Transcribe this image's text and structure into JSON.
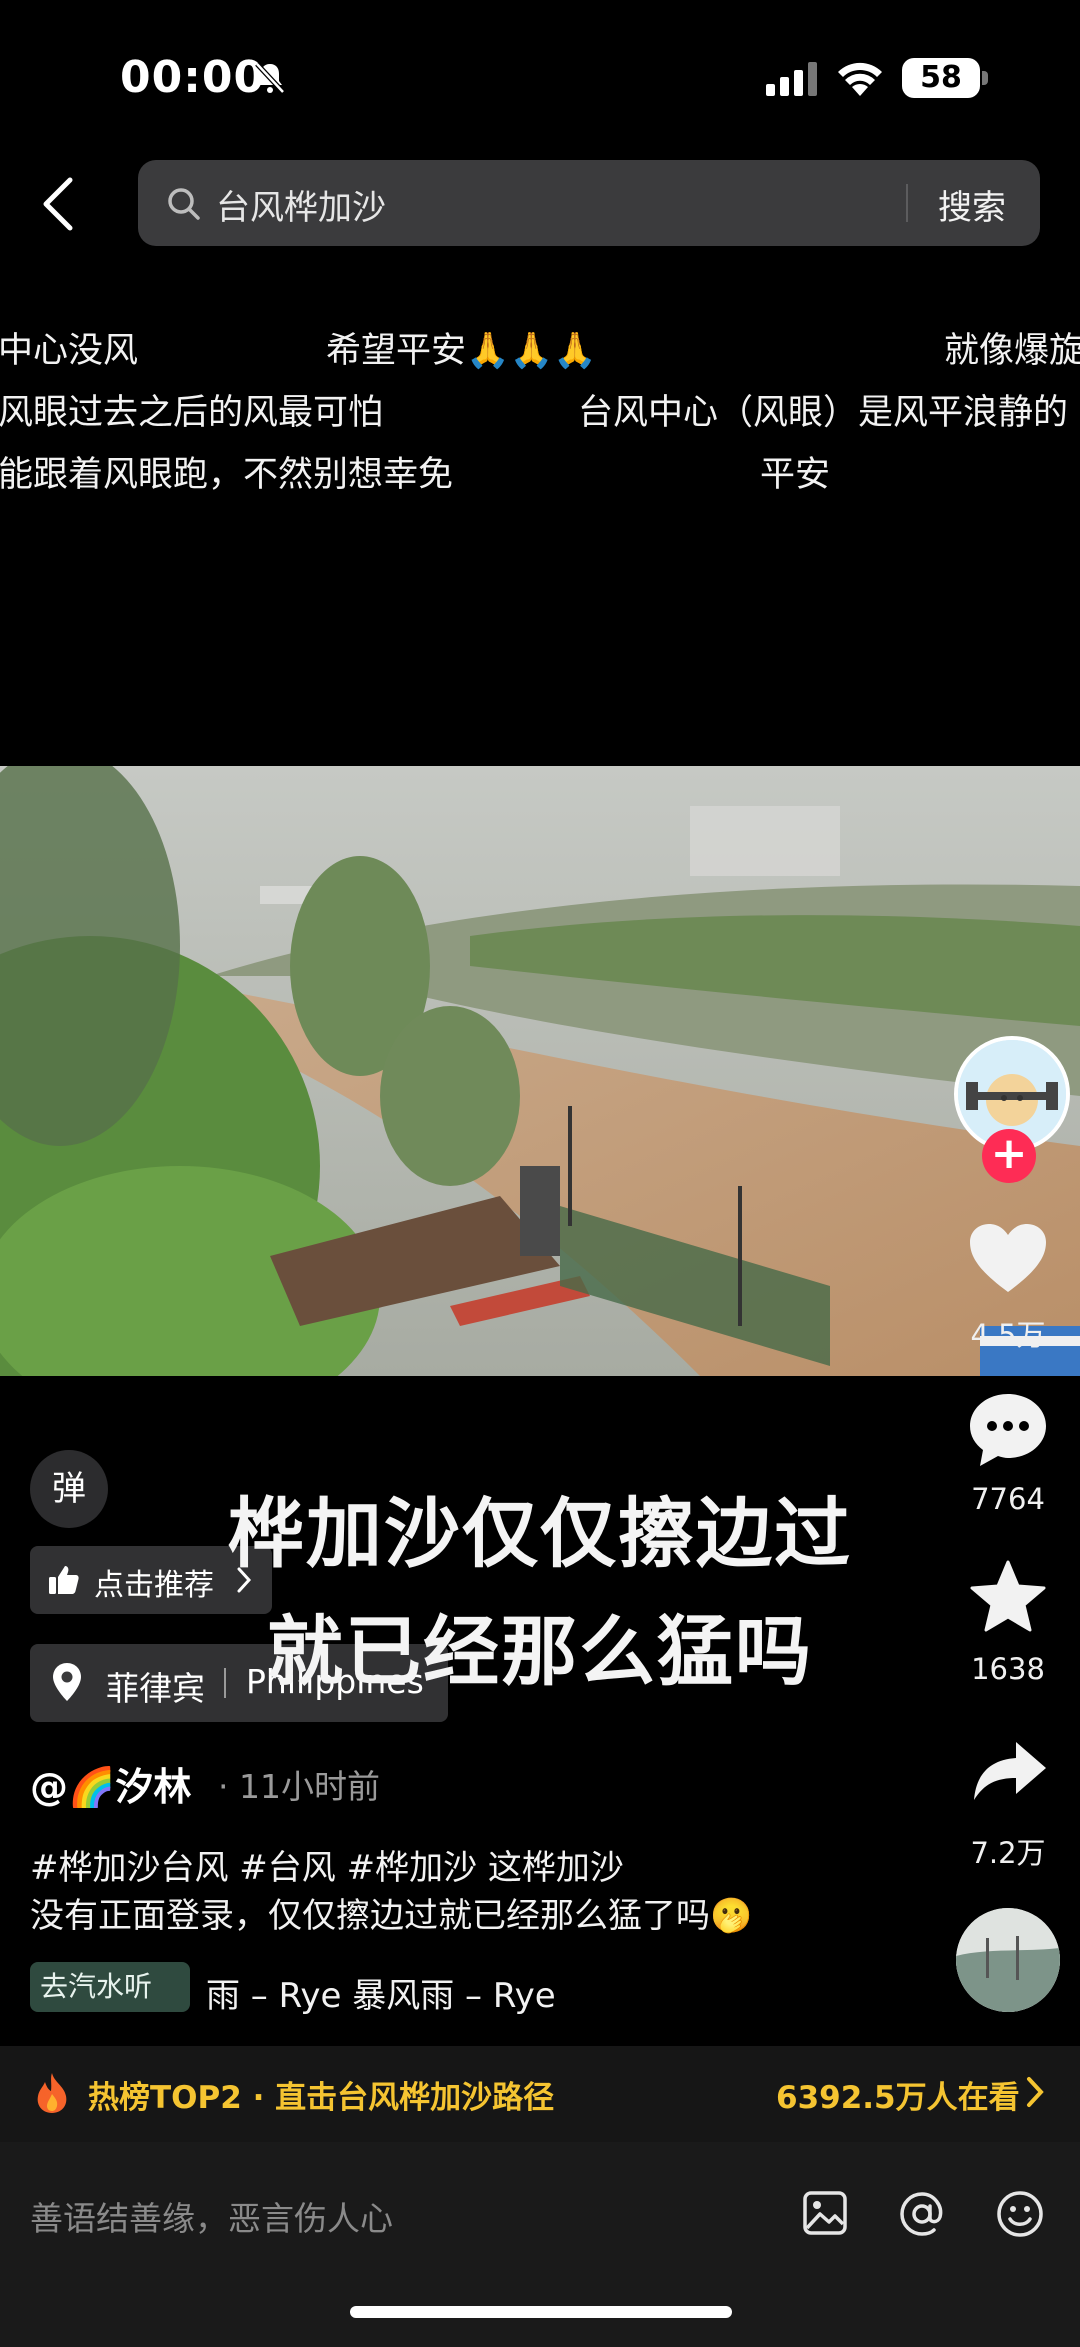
{
  "status_bar": {
    "time": "00:00",
    "battery": "58"
  },
  "search": {
    "query": "台风桦加沙",
    "button_label": "搜索"
  },
  "danmaku": [
    "中心没风",
    "希望平安🙏🙏🙏",
    "就像爆旋",
    "风眼过去之后的风最可怕",
    "台风中心（风眼）是风平浪静的",
    "能跟着风眼跑，不然别想幸免",
    "平安"
  ],
  "video": {
    "overlay_line1": "桦加沙仅仅擦边过",
    "overlay_line2": "就已经那么猛吗"
  },
  "actions": {
    "like_count": "4.5万",
    "comment_count": "7764",
    "favorite_count": "1638",
    "share_count": "7.2万"
  },
  "danmu_toggle": "弹",
  "recommend_label": "点击推荐",
  "location": {
    "name_cn": "菲律宾",
    "name_en": "Philippines"
  },
  "post": {
    "author": "@🌈汐林",
    "time": "· 11小时前",
    "caption_line1": "#桦加沙台风 #台风 #桦加沙 这桦加沙",
    "caption_line2": "没有正面登录，仅仅擦边过就已经那么猛了吗🫢"
  },
  "music": {
    "tag": "去汽水听",
    "text": "雨 – Rye    暴风雨 – Rye"
  },
  "hot": {
    "left": "热榜TOP2 · 直击台风桦加沙路径",
    "right": "6392.5万人在看"
  },
  "comment": {
    "placeholder": "善语结善缘，恶言伤人心"
  },
  "colors": {
    "accent_red": "#fe2c55",
    "hot_gold": "#f5c431"
  }
}
